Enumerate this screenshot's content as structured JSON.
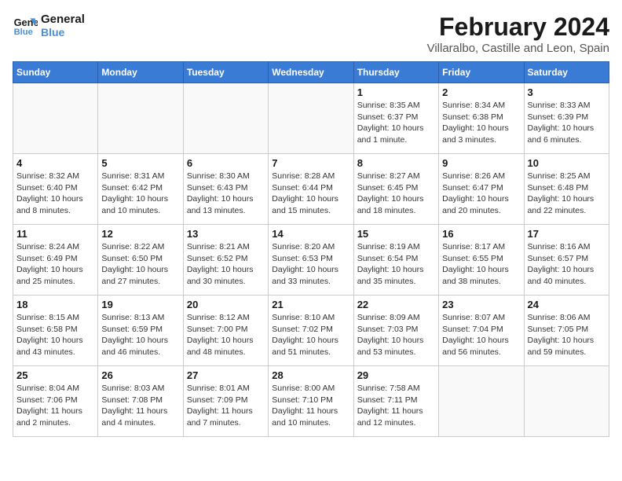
{
  "logo": {
    "line1": "General",
    "line2": "Blue"
  },
  "title": "February 2024",
  "subtitle": "Villaralbo, Castille and Leon, Spain",
  "weekdays": [
    "Sunday",
    "Monday",
    "Tuesday",
    "Wednesday",
    "Thursday",
    "Friday",
    "Saturday"
  ],
  "weeks": [
    [
      {
        "day": "",
        "info": ""
      },
      {
        "day": "",
        "info": ""
      },
      {
        "day": "",
        "info": ""
      },
      {
        "day": "",
        "info": ""
      },
      {
        "day": "1",
        "info": "Sunrise: 8:35 AM\nSunset: 6:37 PM\nDaylight: 10 hours\nand 1 minute."
      },
      {
        "day": "2",
        "info": "Sunrise: 8:34 AM\nSunset: 6:38 PM\nDaylight: 10 hours\nand 3 minutes."
      },
      {
        "day": "3",
        "info": "Sunrise: 8:33 AM\nSunset: 6:39 PM\nDaylight: 10 hours\nand 6 minutes."
      }
    ],
    [
      {
        "day": "4",
        "info": "Sunrise: 8:32 AM\nSunset: 6:40 PM\nDaylight: 10 hours\nand 8 minutes."
      },
      {
        "day": "5",
        "info": "Sunrise: 8:31 AM\nSunset: 6:42 PM\nDaylight: 10 hours\nand 10 minutes."
      },
      {
        "day": "6",
        "info": "Sunrise: 8:30 AM\nSunset: 6:43 PM\nDaylight: 10 hours\nand 13 minutes."
      },
      {
        "day": "7",
        "info": "Sunrise: 8:28 AM\nSunset: 6:44 PM\nDaylight: 10 hours\nand 15 minutes."
      },
      {
        "day": "8",
        "info": "Sunrise: 8:27 AM\nSunset: 6:45 PM\nDaylight: 10 hours\nand 18 minutes."
      },
      {
        "day": "9",
        "info": "Sunrise: 8:26 AM\nSunset: 6:47 PM\nDaylight: 10 hours\nand 20 minutes."
      },
      {
        "day": "10",
        "info": "Sunrise: 8:25 AM\nSunset: 6:48 PM\nDaylight: 10 hours\nand 22 minutes."
      }
    ],
    [
      {
        "day": "11",
        "info": "Sunrise: 8:24 AM\nSunset: 6:49 PM\nDaylight: 10 hours\nand 25 minutes."
      },
      {
        "day": "12",
        "info": "Sunrise: 8:22 AM\nSunset: 6:50 PM\nDaylight: 10 hours\nand 27 minutes."
      },
      {
        "day": "13",
        "info": "Sunrise: 8:21 AM\nSunset: 6:52 PM\nDaylight: 10 hours\nand 30 minutes."
      },
      {
        "day": "14",
        "info": "Sunrise: 8:20 AM\nSunset: 6:53 PM\nDaylight: 10 hours\nand 33 minutes."
      },
      {
        "day": "15",
        "info": "Sunrise: 8:19 AM\nSunset: 6:54 PM\nDaylight: 10 hours\nand 35 minutes."
      },
      {
        "day": "16",
        "info": "Sunrise: 8:17 AM\nSunset: 6:55 PM\nDaylight: 10 hours\nand 38 minutes."
      },
      {
        "day": "17",
        "info": "Sunrise: 8:16 AM\nSunset: 6:57 PM\nDaylight: 10 hours\nand 40 minutes."
      }
    ],
    [
      {
        "day": "18",
        "info": "Sunrise: 8:15 AM\nSunset: 6:58 PM\nDaylight: 10 hours\nand 43 minutes."
      },
      {
        "day": "19",
        "info": "Sunrise: 8:13 AM\nSunset: 6:59 PM\nDaylight: 10 hours\nand 46 minutes."
      },
      {
        "day": "20",
        "info": "Sunrise: 8:12 AM\nSunset: 7:00 PM\nDaylight: 10 hours\nand 48 minutes."
      },
      {
        "day": "21",
        "info": "Sunrise: 8:10 AM\nSunset: 7:02 PM\nDaylight: 10 hours\nand 51 minutes."
      },
      {
        "day": "22",
        "info": "Sunrise: 8:09 AM\nSunset: 7:03 PM\nDaylight: 10 hours\nand 53 minutes."
      },
      {
        "day": "23",
        "info": "Sunrise: 8:07 AM\nSunset: 7:04 PM\nDaylight: 10 hours\nand 56 minutes."
      },
      {
        "day": "24",
        "info": "Sunrise: 8:06 AM\nSunset: 7:05 PM\nDaylight: 10 hours\nand 59 minutes."
      }
    ],
    [
      {
        "day": "25",
        "info": "Sunrise: 8:04 AM\nSunset: 7:06 PM\nDaylight: 11 hours\nand 2 minutes."
      },
      {
        "day": "26",
        "info": "Sunrise: 8:03 AM\nSunset: 7:08 PM\nDaylight: 11 hours\nand 4 minutes."
      },
      {
        "day": "27",
        "info": "Sunrise: 8:01 AM\nSunset: 7:09 PM\nDaylight: 11 hours\nand 7 minutes."
      },
      {
        "day": "28",
        "info": "Sunrise: 8:00 AM\nSunset: 7:10 PM\nDaylight: 11 hours\nand 10 minutes."
      },
      {
        "day": "29",
        "info": "Sunrise: 7:58 AM\nSunset: 7:11 PM\nDaylight: 11 hours\nand 12 minutes."
      },
      {
        "day": "",
        "info": ""
      },
      {
        "day": "",
        "info": ""
      }
    ]
  ]
}
